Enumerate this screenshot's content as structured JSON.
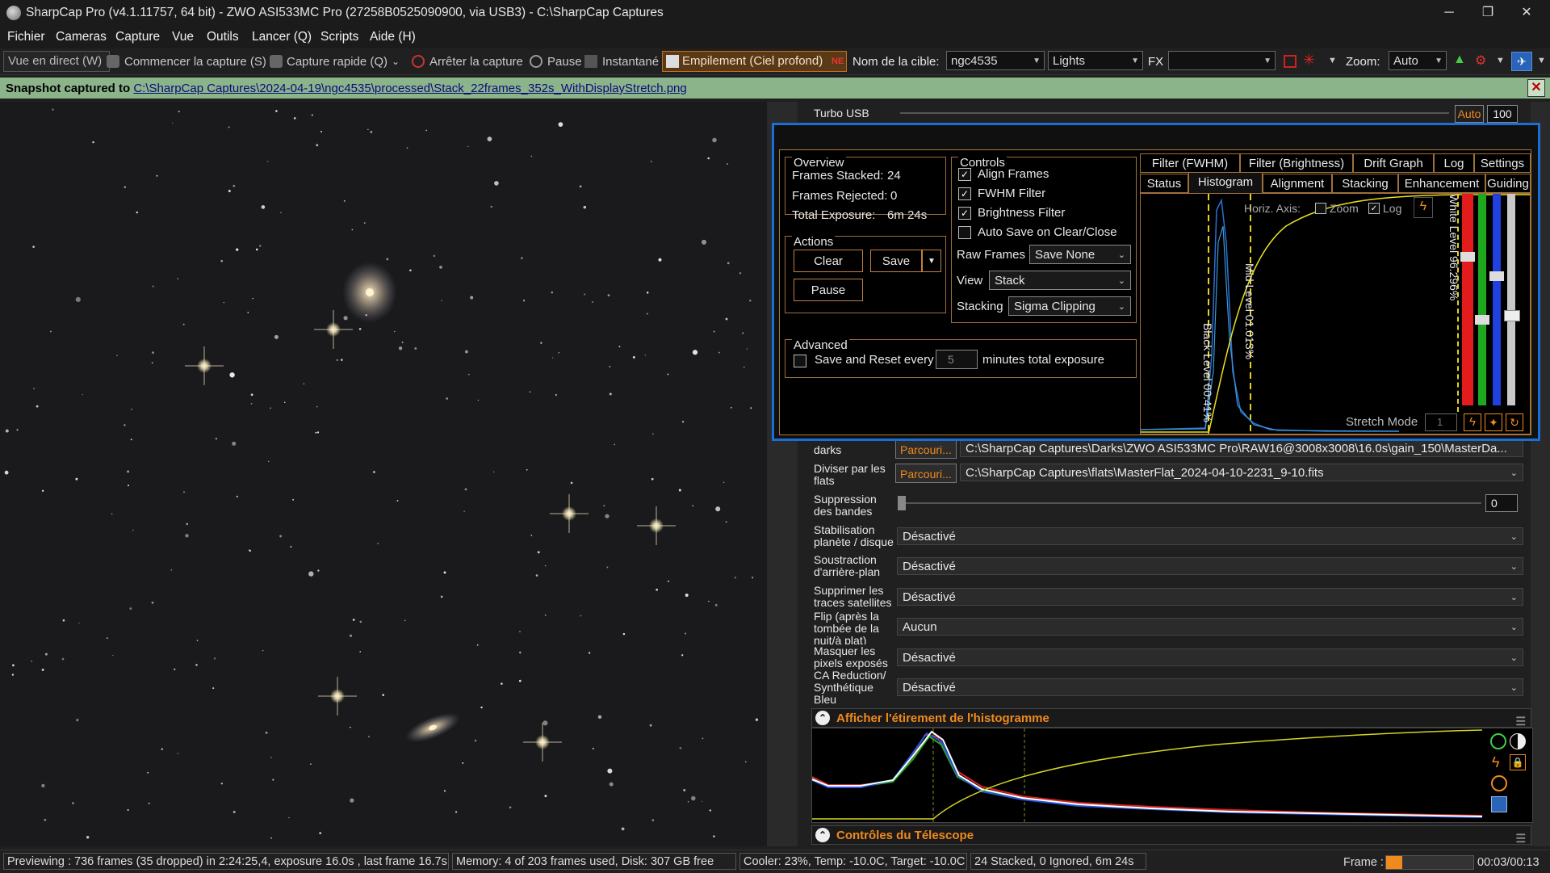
{
  "titlebar": {
    "title": "SharpCap Pro (v4.1.11757, 64 bit) - ZWO ASI533MC Pro (27258B0525090900, via USB3) - C:\\SharpCap Captures",
    "minimize": "─",
    "restore": "❐",
    "close": "✕"
  },
  "menu": [
    "Fichier",
    "Cameras",
    "Capture",
    "Vue",
    "Outils",
    "Lancer (Q)",
    "Scripts",
    "Aide (H)"
  ],
  "toolbar": {
    "live_view": "Vue en direct (W)",
    "start_capture": "Commencer la capture (S)",
    "quick_capture": "Capture rapide (Q)",
    "stop_capture": "Arrêter la capture",
    "pause": "Pause",
    "snapshot": "Instantané",
    "live_stack": "Empilement (Ciel profond)",
    "target_label": "Nom de la cible:",
    "target_value": "ngc4535",
    "frame_type": "Lights",
    "fx_label": "FX",
    "fx_value": "",
    "zoom_label": "Zoom:",
    "zoom_value": "Auto"
  },
  "notify": {
    "prefix": "Snapshot captured to ",
    "path": "C:\\SharpCap Captures\\2024-04-19\\ngc4535\\processed\\Stack_22frames_352s_WithDisplayStretch.png",
    "close": "✕"
  },
  "right_panel": {
    "turbo_label": "Turbo USB",
    "turbo_auto": "Auto",
    "turbo_value": "100",
    "darks_label": "darks",
    "darks_browse": "Parcouri...",
    "darks_path": "C:\\SharpCap Captures\\Darks\\ZWO ASI533MC Pro\\RAW16@3008x3008\\16.0s\\gain_150\\MasterDa...",
    "flats_label": "Diviser par les flats",
    "flats_browse": "Parcouri...",
    "flats_path": "C:\\SharpCap Captures\\flats\\MasterFlat_2024-04-10-2231_9-10.fits",
    "banding_label": "Suppression des bandes",
    "banding_value": "0",
    "rows": [
      {
        "label": "Stabilisation planète / disque",
        "value": "Désactivé"
      },
      {
        "label": "Soustraction d'arrière-plan",
        "value": "Désactivé"
      },
      {
        "label": "Supprimer les traces satellites",
        "value": "Désactivé"
      },
      {
        "label": "Flip (après la tombée de la nuit/à plat)",
        "value": "Aucun"
      },
      {
        "label": "Masquer les pixels exposés",
        "value": "Désactivé"
      },
      {
        "label": "CA Reduction/ Synthétique Bleu",
        "value": "Désactivé"
      }
    ],
    "hist_section": "Afficher l'étirement de l'histogramme",
    "telescope_section": "Contrôles du Télescope"
  },
  "livestack": {
    "overview": {
      "title": "Overview",
      "stacked_label": "Frames Stacked:",
      "stacked_value": "24",
      "rejected_label": "Frames Rejected:",
      "rejected_value": "0",
      "exposure_label": "Total Exposure:",
      "exposure_value": "6m 24s"
    },
    "actions": {
      "title": "Actions",
      "clear": "Clear",
      "save": "Save",
      "pause": "Pause"
    },
    "advanced": {
      "title": "Advanced",
      "save_reset": "Save and Reset every",
      "minutes_value": "5",
      "minutes_suffix": "minutes total exposure"
    },
    "controls": {
      "title": "Controls",
      "align": "Align Frames",
      "fwhm": "FWHM Filter",
      "brightness": "Brightness Filter",
      "autosave": "Auto Save on Clear/Close",
      "raw_label": "Raw Frames",
      "raw_value": "Save None",
      "view_label": "View",
      "view_value": "Stack",
      "stacking_label": "Stacking",
      "stacking_value": "Sigma Clipping"
    },
    "tabs_row1": [
      "Filter (FWHM)",
      "Filter (Brightness)",
      "Drift Graph",
      "Log",
      "Settings"
    ],
    "tabs_row2": [
      "Status",
      "Histogram",
      "Alignment",
      "Stacking",
      "Enhancement",
      "Guiding"
    ],
    "hist": {
      "horiz_axis": "Horiz. Axis:",
      "zoom": "Zoom",
      "log": "Log",
      "black_level": "Black Level 00.41%",
      "mid_level": "Mid Level 01.013%",
      "white_level": "White Level 96.296%",
      "stretch_mode": "Stretch Mode",
      "stretch_value": "1"
    }
  },
  "statusbar": {
    "preview": "Previewing : 736 frames (35 dropped) in 2:24:25,4, exposure 16.0s , last frame 16.7s",
    "memory": "Memory: 4 of 203 frames used, Disk: 307 GB free",
    "cooler": "Cooler: 23%, Temp: -10.0C, Target: -10.0C",
    "stack": "24 Stacked, 0 Ignored, 6m 24s",
    "frame_label": "Frame :",
    "time": "00:03/00:13"
  },
  "colors": {
    "accent_orange": "#f08a1c",
    "selection_blue": "#1a6fd6",
    "notify_green": "#8bb48b"
  }
}
